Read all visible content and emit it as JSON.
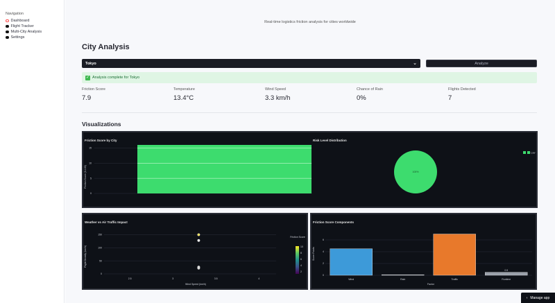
{
  "nav": {
    "title": "Navigation",
    "items": [
      {
        "label": "Dashboard",
        "active": true
      },
      {
        "label": "Flight Tracker",
        "active": false
      },
      {
        "label": "Multi-City Analysis",
        "active": false
      },
      {
        "label": "Settings",
        "active": false
      }
    ]
  },
  "header": {
    "subtitle": "Real-time logistics friction analysis for cities worldwide"
  },
  "city_analysis": {
    "title": "City Analysis",
    "selected_city": "Tokyo",
    "analyze_label": "Analyze",
    "success_text": "Analysis complete for Tokyo"
  },
  "metrics": [
    {
      "label": "Friction Score",
      "value": "7.9"
    },
    {
      "label": "Temperature",
      "value": "13.4°C"
    },
    {
      "label": "Wind Speed",
      "value": "3.3 km/h"
    },
    {
      "label": "Chance of Rain",
      "value": "0%"
    },
    {
      "label": "Flights Detected",
      "value": "7"
    }
  ],
  "visualizations": {
    "title": "Visualizations"
  },
  "manage_app": "Manage app",
  "colors": {
    "accent": "#ff4b4b",
    "bar_green": "#3ddc6e",
    "wind": "#3d9ad9",
    "traffic": "#e8792b",
    "panel": "#0e1117"
  },
  "chart_data": [
    {
      "type": "bar",
      "title": "Friction Score by City",
      "ylabel": "Friction Score (0-100)",
      "yticks": [
        "0",
        "5",
        "10",
        "15"
      ],
      "ylim": [
        0,
        16
      ],
      "categories": [
        ""
      ],
      "values": [
        16
      ],
      "color": "#3ddc6e"
    },
    {
      "type": "pie",
      "title": "Risk Level Distribution",
      "labels": [
        "Low"
      ],
      "values": [
        100
      ],
      "slice_label": "100%",
      "legend": "right"
    },
    {
      "type": "scatter",
      "title": "Weather vs Air Traffic Impact",
      "xlabel": "Wind Speed (km/h)",
      "ylabel": "Flight Density (km/h)",
      "xticks": [
        "2.5",
        "3",
        "3.5",
        "4"
      ],
      "yticks": [
        "0",
        "50",
        "100",
        "150"
      ],
      "xlim": [
        2.2,
        4.2
      ],
      "ylim": [
        0,
        170
      ],
      "points": [
        {
          "x": 3.3,
          "y": 150
        },
        {
          "x": 3.3,
          "y": 128
        },
        {
          "x": 3.3,
          "y": 26
        },
        {
          "x": 3.3,
          "y": 22
        }
      ],
      "colorbar": {
        "title": "Friction Score",
        "ticks": [
          "10",
          "8",
          "6",
          "4",
          "2"
        ]
      }
    },
    {
      "type": "bar",
      "title": "Friction Score Components",
      "xlabel": "Factor",
      "ylabel": "Score Points",
      "categories": [
        "Wind",
        "Rain",
        "Traffic",
        "Runtime"
      ],
      "values": [
        4.5,
        0.1,
        7,
        0.5
      ],
      "data_labels": [
        "",
        "",
        "",
        "0.5"
      ],
      "colors": [
        "#3d9ad9",
        "#9aa0aa",
        "#e8792b",
        "#9aa0aa"
      ],
      "ylim": [
        0,
        8
      ]
    }
  ]
}
